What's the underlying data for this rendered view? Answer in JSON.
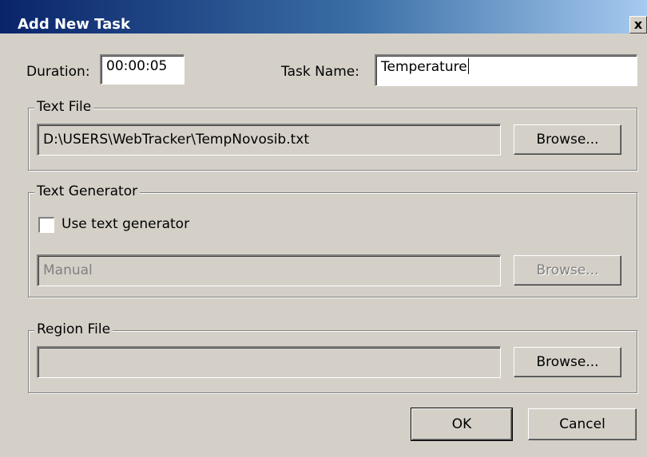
{
  "dialog": {
    "title": "Add New Task",
    "close_label": "x"
  },
  "duration": {
    "label": "Duration:",
    "value": "00:00:05"
  },
  "task_name": {
    "label": "Task Name:",
    "value": "Temperature"
  },
  "text_file": {
    "legend": "Text File",
    "path": "D:\\USERS\\WebTracker\\TempNovosib.txt",
    "browse_label": "Browse..."
  },
  "text_generator": {
    "legend": "Text Generator",
    "checkbox_label": "Use text generator",
    "checked": false,
    "value": "Manual",
    "browse_label": "Browse..."
  },
  "region_file": {
    "legend": "Region File",
    "path": "",
    "browse_label": "Browse..."
  },
  "buttons": {
    "ok": "OK",
    "cancel": "Cancel"
  }
}
